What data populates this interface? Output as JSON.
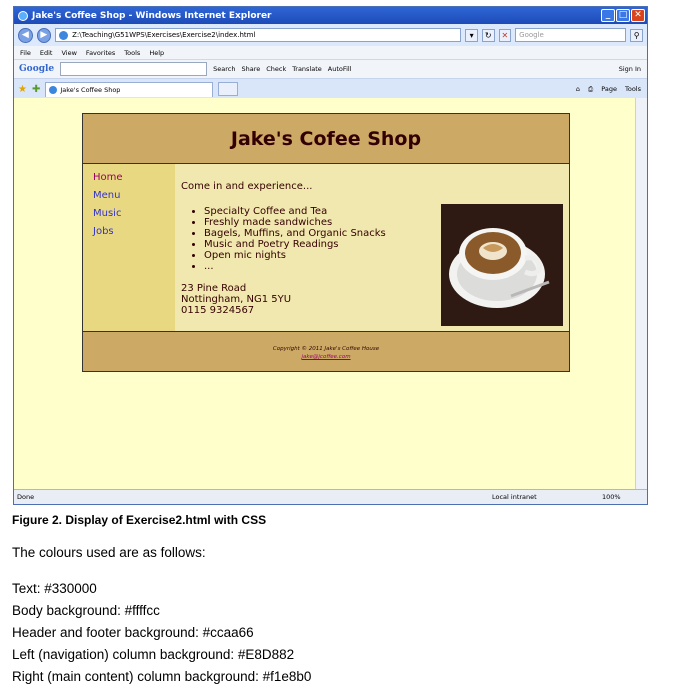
{
  "browser": {
    "window_title": "Jake's Coffee Shop - Windows Internet Explorer",
    "address": "Z:\\Teaching\\G51WPS\\Exercises\\Exercise2\\index.html",
    "search_placeholder": "Google",
    "menu": [
      "File",
      "Edit",
      "View",
      "Favorites",
      "Tools",
      "Help"
    ],
    "google_bar": {
      "logo": "Google",
      "items": [
        "Search",
        "Share",
        "Check",
        "Translate",
        "AutoFill"
      ],
      "sign_in": "Sign In"
    },
    "tab_title": "Jake's Coffee Shop",
    "tab_tools": [
      "Page",
      "Tools"
    ],
    "status": {
      "text": "Done",
      "zone": "Local intranet",
      "zoom": "100%"
    }
  },
  "page": {
    "header": "Jake's Cofee Shop",
    "nav": [
      "Home",
      "Menu",
      "Music",
      "Jobs"
    ],
    "intro": "Come in and experience...",
    "list": [
      "Specialty Coffee and Tea",
      "Freshly made sandwiches",
      "Bagels, Muffins, and Organic Snacks",
      "Music and Poetry Readings",
      "Open mic nights",
      "..."
    ],
    "address_lines": [
      "23 Pine Road",
      "Nottingham, NG1 5YU",
      "0115 9324567"
    ],
    "footer_copyright": "Copyright © 2011 Jake's Coffee House",
    "footer_email": "jake@jcoffee.com"
  },
  "document": {
    "caption": "Figure 2. Display of Exercise2.html with CSS",
    "intro": "The colours used are as follows:",
    "colours": [
      "Text: #330000",
      "Body background: #ffffcc",
      "Header and footer background: #ccaa66",
      "Left (navigation) column background: #E8D882",
      "Right (main content) column background: #f1e8b0"
    ]
  }
}
